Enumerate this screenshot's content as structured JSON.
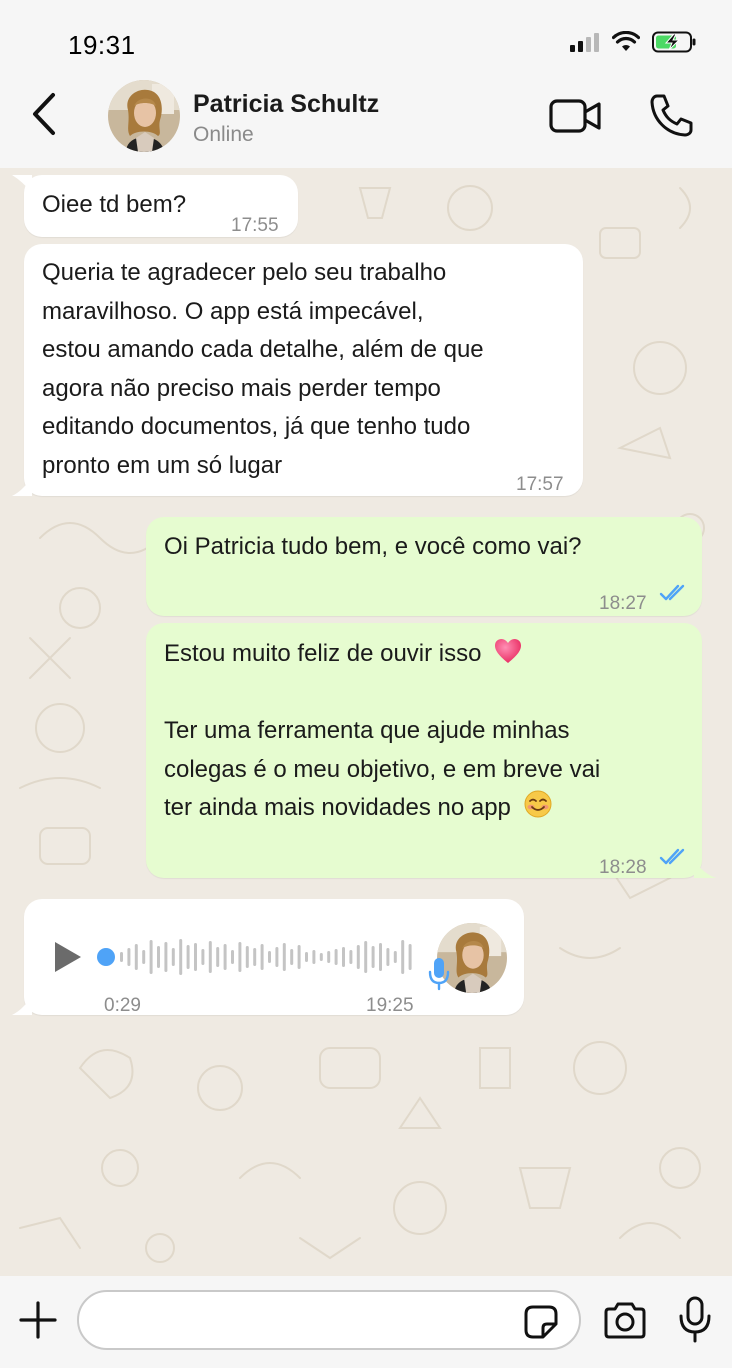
{
  "status_bar": {
    "time": "19:31"
  },
  "header": {
    "contact_name": "Patricia Schultz",
    "contact_status": "Online"
  },
  "messages": [
    {
      "direction": "incoming",
      "lines": [
        "Oiee td bem?"
      ],
      "time": "17:55"
    },
    {
      "direction": "incoming",
      "lines": [
        "Queria te agradecer pelo seu trabalho",
        "maravilhoso. O app está impecável,",
        "estou amando cada detalhe, além de que",
        "agora não preciso mais perder tempo",
        "editando documentos, já que tenho tudo",
        "pronto em um só lugar"
      ],
      "time": "17:57"
    },
    {
      "direction": "outgoing",
      "lines": [
        "Oi Patricia tudo bem, e você como vai?"
      ],
      "time": "18:27",
      "status": "read"
    },
    {
      "direction": "outgoing",
      "line1": "Estou muito feliz de ouvir isso",
      "line1_emoji": "heart",
      "lines2": [
        "Ter uma ferramenta que ajude minhas",
        "colegas é o meu objetivo, e em breve vai"
      ],
      "line_last": "ter ainda mais novidades no app",
      "line_last_emoji": "smiling-face",
      "time": "18:28",
      "status": "read"
    }
  ],
  "voice_message": {
    "direction": "incoming",
    "duration": "0:29",
    "time": "19:25",
    "progress": 0
  },
  "input": {
    "placeholder": "",
    "value": ""
  },
  "colors": {
    "incoming_bubble": "#ffffff",
    "outgoing_bubble": "#e6fcd0",
    "read_ticks": "#4fa3f7",
    "chat_background": "#efeae2"
  }
}
